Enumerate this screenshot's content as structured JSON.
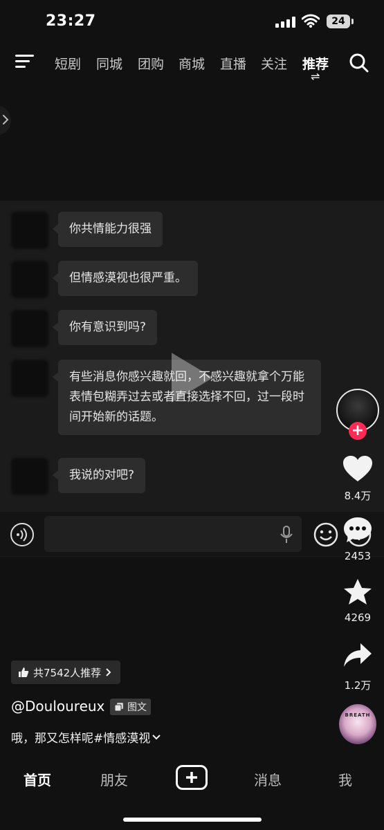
{
  "status_bar": {
    "time": "23:27",
    "battery": "24"
  },
  "top_nav": {
    "tabs": [
      "短剧",
      "同城",
      "团购",
      "商城",
      "直播",
      "关注",
      "推荐"
    ],
    "active_tab": "推荐",
    "active_indicator": "⇌"
  },
  "chat": {
    "messages": [
      "你共情能力很强",
      "但情感漠视也很严重。",
      "你有意识到吗?",
      "有些消息你感兴趣就回，不感兴趣就拿个万能表情包糊弄过去或者直接选择不回，过一段时间开始新的话题。",
      "我说的对吧?"
    ]
  },
  "actions": {
    "like_count": "8.4万",
    "comment_count": "2453",
    "favorite_count": "4269",
    "share_count": "1.2万",
    "follow_symbol": "+",
    "music_disc_text": "BREATH"
  },
  "post": {
    "recommend_label": "共7542人推荐",
    "author": "@Douloureux",
    "type_badge": "图文",
    "caption": "哦，那又怎样呢#情感漠视"
  },
  "bottom_tabs": {
    "home": "首页",
    "friends": "朋友",
    "messages": "消息",
    "me": "我"
  },
  "colors": {
    "accent": "#fe2c55",
    "background": "#111111",
    "bubble": "#2d2d2d"
  }
}
